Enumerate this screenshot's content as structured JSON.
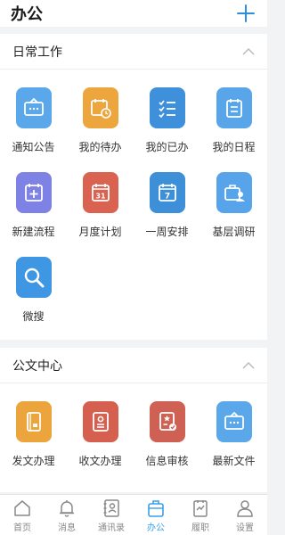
{
  "header": {
    "title": "办公",
    "add_icon": "plus-icon"
  },
  "sections": [
    {
      "title": "日常工作",
      "collapse_icon": "chevron-up-icon",
      "items": [
        {
          "label": "通知公告",
          "icon": "notice-board-icon",
          "color": "#5aa7ea"
        },
        {
          "label": "我的待办",
          "icon": "calendar-clock-icon",
          "color": "#eda63e"
        },
        {
          "label": "我的已办",
          "icon": "checklist-icon",
          "color": "#3f90db"
        },
        {
          "label": "我的日程",
          "icon": "schedule-icon",
          "color": "#59a5ea"
        },
        {
          "label": "新建流程",
          "icon": "calendar-plus-icon",
          "color": "#7f82e5"
        },
        {
          "label": "月度计划",
          "icon": "calendar-31-icon",
          "color": "#d96251"
        },
        {
          "label": "一周安排",
          "icon": "calendar-7-icon",
          "color": "#3d8fd8"
        },
        {
          "label": "基层调研",
          "icon": "briefcase-person-icon",
          "color": "#58a4ea"
        },
        {
          "label": "微搜",
          "icon": "magnifier-icon",
          "color": "#3f96e2"
        }
      ]
    },
    {
      "title": "公文中心",
      "collapse_icon": "chevron-up-icon",
      "items": [
        {
          "label": "发文办理",
          "icon": "document-send-icon",
          "color": "#eca43c"
        },
        {
          "label": "收文办理",
          "icon": "document-receive-icon",
          "color": "#d6604f"
        },
        {
          "label": "信息审核",
          "icon": "certificate-icon",
          "color": "#cf6154"
        },
        {
          "label": "最新文件",
          "icon": "notice-board-icon",
          "color": "#5aa7ea"
        }
      ]
    }
  ],
  "tabs": [
    {
      "label": "首页",
      "icon": "home-icon",
      "active": false
    },
    {
      "label": "消息",
      "icon": "bell-icon",
      "active": false
    },
    {
      "label": "通讯录",
      "icon": "contacts-icon",
      "active": false
    },
    {
      "label": "办公",
      "icon": "briefcase-icon",
      "active": true
    },
    {
      "label": "履职",
      "icon": "duty-chart-icon",
      "active": false
    },
    {
      "label": "设置",
      "icon": "person-icon",
      "active": false
    }
  ],
  "colors": {
    "accent": "#2d8ee0",
    "tab_active": "#3aa0e8",
    "tab_inactive": "#888888"
  }
}
